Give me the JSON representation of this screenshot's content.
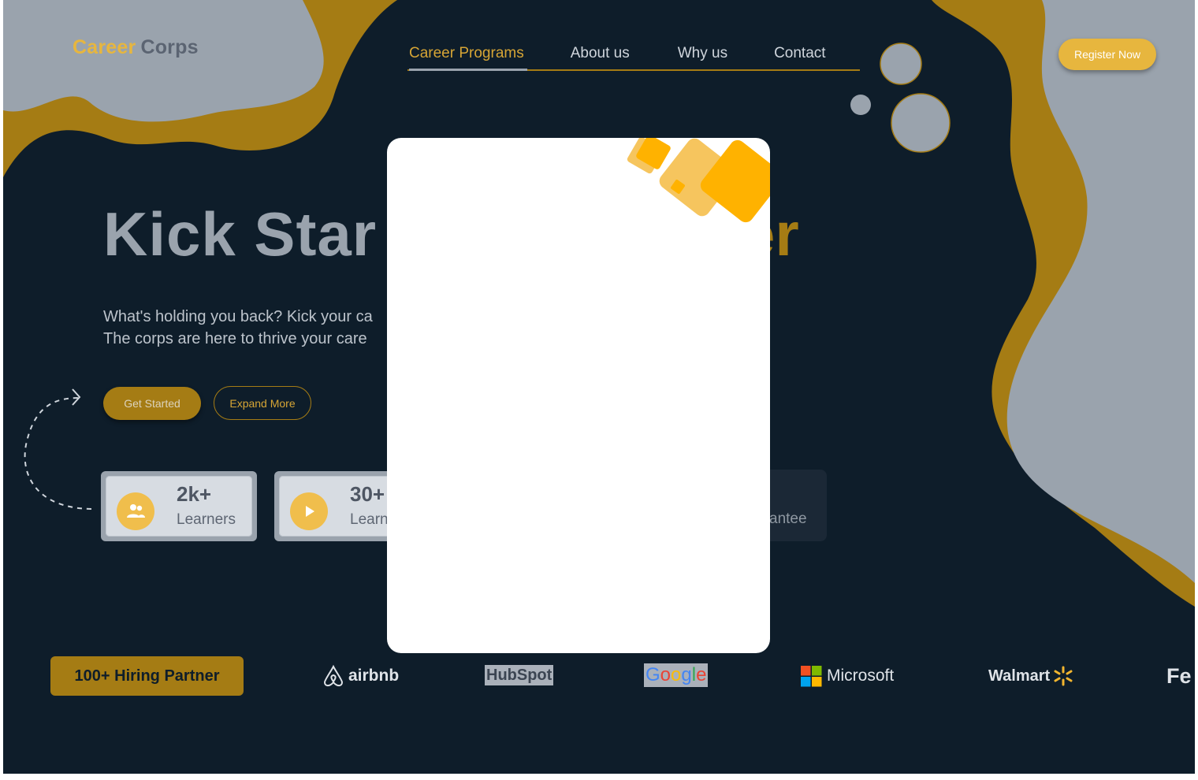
{
  "brand": {
    "first": "Career",
    "second": "Corps"
  },
  "nav": {
    "items": [
      {
        "label": "Career Programs",
        "active": true
      },
      {
        "label": "About us",
        "active": false
      },
      {
        "label": "Why us",
        "active": false
      },
      {
        "label": "Contact",
        "active": false
      }
    ]
  },
  "header": {
    "register_label": "Register Now"
  },
  "hero": {
    "title_visible": "Kick Star",
    "title_end_visible": "er",
    "subtitle_line1": "What's holding you back? Kick your ca",
    "subtitle_line2": "The corps are here to thrive your care",
    "get_started_label": "Get Started",
    "expand_more_label": "Expand More"
  },
  "stats": [
    {
      "value": "2k+",
      "label": "Learners",
      "icon": "users-icon"
    },
    {
      "value": "30+",
      "label": "Learne",
      "icon": "play-icon"
    }
  ],
  "stat_partial_label": "antee",
  "hiring": {
    "label": "100+ Hiring Partner",
    "partners": [
      "airbnb",
      "HubSpot",
      "Google",
      "Microsoft",
      "Walmart",
      "Fe"
    ]
  },
  "colors": {
    "navy": "#0e1d2a",
    "gold": "#a57c14",
    "accent_yellow": "#e7b63e",
    "grey": "#9aa3ad"
  }
}
